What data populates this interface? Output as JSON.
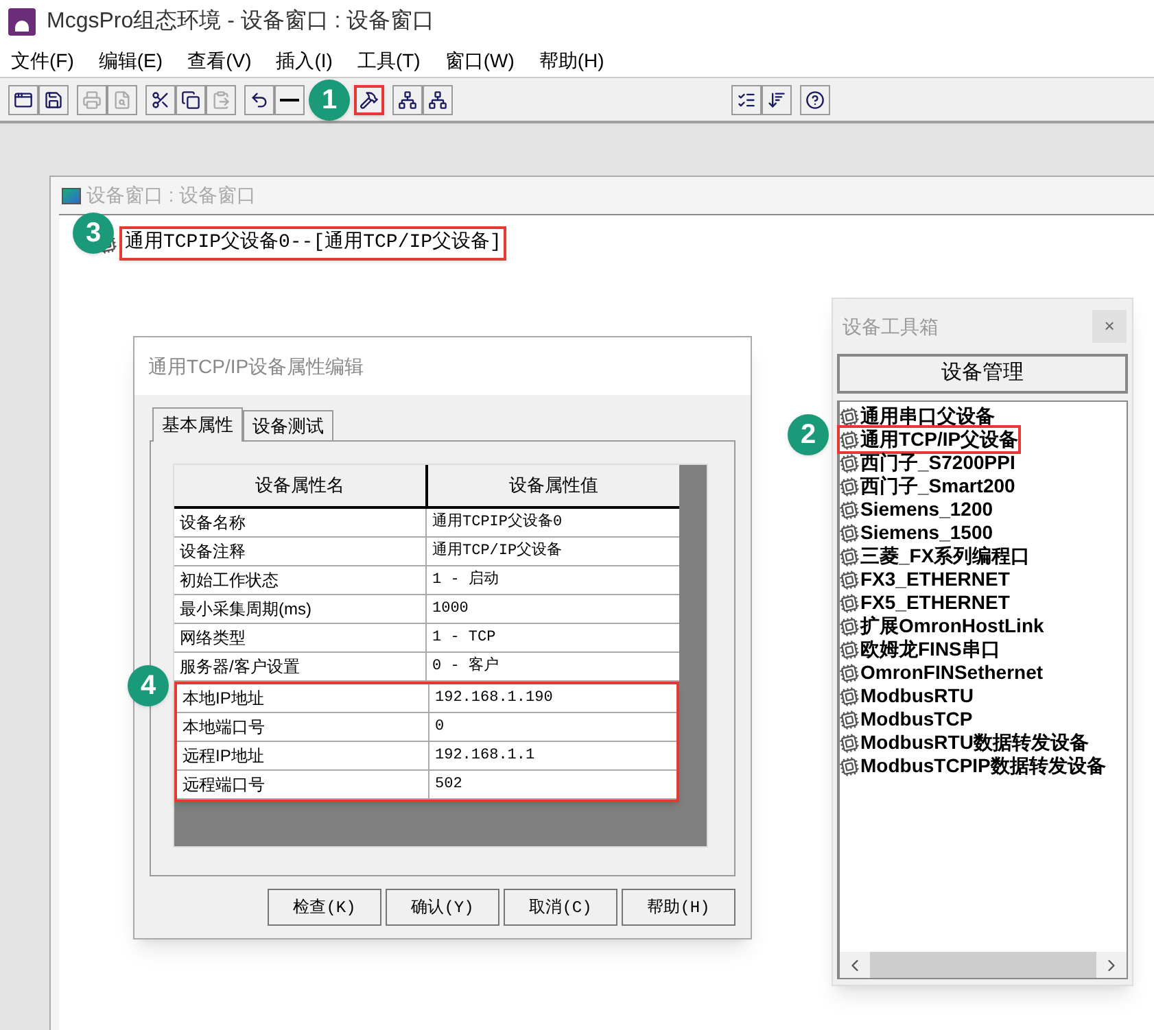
{
  "window": {
    "title": "McgsPro组态环境 - 设备窗口 : 设备窗口"
  },
  "menu": [
    "文件(F)",
    "编辑(E)",
    "查看(V)",
    "插入(I)",
    "工具(T)",
    "窗口(W)",
    "帮助(H)"
  ],
  "toolbar": {
    "left": [
      [
        {
          "kind": "windows",
          "disabled": false,
          "highlighted": false
        },
        {
          "kind": "save",
          "disabled": false,
          "highlighted": false
        }
      ],
      [
        {
          "kind": "print",
          "disabled": true,
          "highlighted": false
        },
        {
          "kind": "preview",
          "disabled": true,
          "highlighted": false
        }
      ],
      [
        {
          "kind": "cut",
          "disabled": false,
          "highlighted": false
        },
        {
          "kind": "copy",
          "disabled": false,
          "highlighted": false
        },
        {
          "kind": "paste",
          "disabled": true,
          "highlighted": false
        }
      ],
      [
        {
          "kind": "undo",
          "disabled": false,
          "highlighted": false
        },
        {
          "kind": "line",
          "disabled": false,
          "highlighted": false
        }
      ],
      [
        {
          "kind": "tools",
          "disabled": false,
          "highlighted": true,
          "callout": "1"
        }
      ],
      [
        {
          "kind": "tree-up",
          "disabled": false,
          "highlighted": false
        },
        {
          "kind": "tree-down",
          "disabled": false,
          "highlighted": false
        }
      ]
    ],
    "right": [
      [
        {
          "kind": "check",
          "disabled": false,
          "highlighted": false
        },
        {
          "kind": "sort",
          "disabled": false,
          "highlighted": false
        }
      ],
      [
        {
          "kind": "help",
          "disabled": false,
          "highlighted": false
        }
      ]
    ]
  },
  "device_window": {
    "title": "设备窗口 : 设备窗口",
    "tree": [
      {
        "label": "通用TCPIP父设备0--[通用TCP/IP父设备]",
        "highlighted": true,
        "callout": "3"
      }
    ]
  },
  "property_dialog": {
    "title": "通用TCP/IP设备属性编辑",
    "tabs": [
      {
        "label": "基本属性",
        "selected": true
      },
      {
        "label": "设备测试",
        "selected": false
      }
    ],
    "columns": [
      "设备属性名",
      "设备属性值"
    ],
    "rows": [
      {
        "name": "设备名称",
        "value": "通用TCPIP父设备0",
        "highlighted": false
      },
      {
        "name": "设备注释",
        "value": "通用TCP/IP父设备",
        "highlighted": false
      },
      {
        "name": "初始工作状态",
        "value": "1 - 启动",
        "highlighted": false
      },
      {
        "name": "最小采集周期(ms)",
        "value": "1000",
        "highlighted": false
      },
      {
        "name": "网络类型",
        "value": "1 - TCP",
        "highlighted": false
      },
      {
        "name": "服务器/客户设置",
        "value": "0 - 客户",
        "highlighted": false
      },
      {
        "name": "本地IP地址",
        "value": "192.168.1.190",
        "highlighted": true
      },
      {
        "name": "本地端口号",
        "value": "0",
        "highlighted": true
      },
      {
        "name": "远程IP地址",
        "value": "192.168.1.1",
        "highlighted": true
      },
      {
        "name": "远程端口号",
        "value": "502",
        "highlighted": true
      }
    ],
    "rows_callout": "4",
    "buttons": [
      "检查(K)",
      "确认(Y)",
      "取消(C)",
      "帮助(H)"
    ]
  },
  "toolbox": {
    "title": "设备工具箱",
    "close": "×",
    "manage_button": "设备管理",
    "items": [
      {
        "label": "通用串口父设备",
        "highlighted": false
      },
      {
        "label": "通用TCP/IP父设备",
        "highlighted": true,
        "callout": "2"
      },
      {
        "label": "西门子_S7200PPI",
        "highlighted": false
      },
      {
        "label": "西门子_Smart200",
        "highlighted": false
      },
      {
        "label": "Siemens_1200",
        "highlighted": false
      },
      {
        "label": "Siemens_1500",
        "highlighted": false
      },
      {
        "label": "三菱_FX系列编程口",
        "highlighted": false
      },
      {
        "label": "FX3_ETHERNET",
        "highlighted": false
      },
      {
        "label": "FX5_ETHERNET",
        "highlighted": false
      },
      {
        "label": "扩展OmronHostLink",
        "highlighted": false
      },
      {
        "label": "欧姆龙FINS串口",
        "highlighted": false
      },
      {
        "label": "OmronFINSethernet",
        "highlighted": false
      },
      {
        "label": "ModbusRTU",
        "highlighted": false
      },
      {
        "label": "ModbusTCP",
        "highlighted": false
      },
      {
        "label": "ModbusRTU数据转发设备",
        "highlighted": false
      },
      {
        "label": "ModbusTCPIP数据转发设备",
        "highlighted": false
      }
    ]
  }
}
